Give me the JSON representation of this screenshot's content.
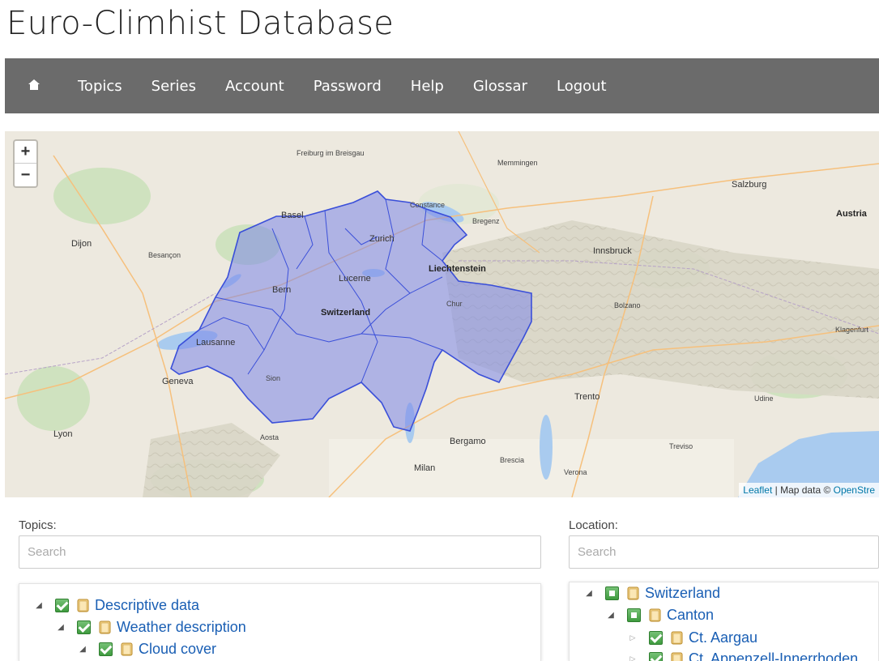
{
  "site": {
    "title": "Euro-Climhist Database"
  },
  "nav": {
    "home_icon": "home-icon",
    "items": [
      "Topics",
      "Series",
      "Account",
      "Password",
      "Help",
      "Glossar",
      "Logout"
    ]
  },
  "map": {
    "zoom_in": "+",
    "zoom_out": "−",
    "attribution": {
      "leaflet": "Leaflet",
      "sep": " | Map data © ",
      "osm": "OpenStre"
    },
    "labels": {
      "switzerland": "Switzerland",
      "liechtenstein": "Liechtenstein",
      "austria": "Austria",
      "zurich": "Zurich",
      "bern": "Bern",
      "lucerne": "Lucerne",
      "lausanne": "Lausanne",
      "geneva": "Geneva",
      "basel": "Basel",
      "milan": "Milan",
      "innsbruck": "Innsbruck",
      "salzburg": "Salzburg",
      "dijon": "Dijon",
      "besancon": "Besançon",
      "lyon": "Lyon",
      "trento": "Trento",
      "bergamo": "Bergamo",
      "munich_area": "Memmingen",
      "freiburg": "Freiburg im Breisgau",
      "constance": "Constance",
      "bregenz": "Bregenz",
      "verona": "Verona",
      "klagenfurt": "Klagenfurt",
      "udine": "Udine",
      "treviso": "Treviso",
      "aosta": "Aosta",
      "sion": "Sion",
      "chur": "Chur",
      "bolzano": "Bolzano",
      "brescia": "Brescia"
    },
    "region_color": "#7b86e8",
    "region_border": "#3a4fd9"
  },
  "topics": {
    "label": "Topics:",
    "search_placeholder": "Search",
    "tree": [
      {
        "text": "Descriptive data",
        "expanded": true,
        "state": "full"
      },
      {
        "text": "Weather description",
        "expanded": true,
        "state": "full"
      },
      {
        "text": "Cloud cover",
        "expanded": true,
        "state": "full"
      }
    ]
  },
  "location": {
    "label": "Location:",
    "search_placeholder": "Search",
    "tree": [
      {
        "text": "Switzerland",
        "expanded": true,
        "state": "partial"
      },
      {
        "text": "Canton",
        "expanded": true,
        "state": "partial"
      },
      {
        "text": "Ct. Aargau",
        "expanded": false,
        "state": "full"
      },
      {
        "text": "Ct. Appenzell-Innerrhoden",
        "expanded": false,
        "state": "full"
      }
    ]
  }
}
